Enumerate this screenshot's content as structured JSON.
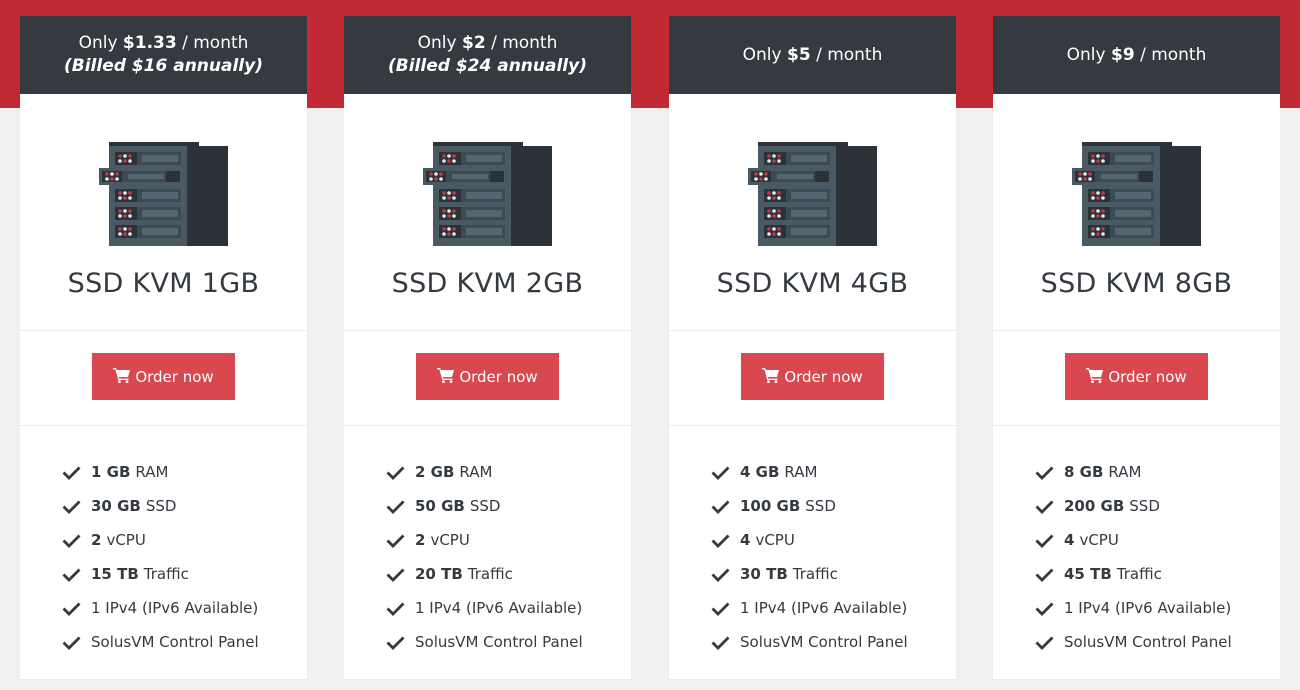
{
  "plans": [
    {
      "price_prefix": "Only",
      "price": "$1.33",
      "price_suffix": "/ month",
      "billed": "(Billed $16 annually)",
      "name": "SSD KVM 1GB",
      "order_label": "Order now",
      "features": [
        {
          "bold": "1 GB",
          "text": "RAM"
        },
        {
          "bold": "30 GB",
          "text": "SSD"
        },
        {
          "bold": "2",
          "text": "vCPU"
        },
        {
          "bold": "15 TB",
          "text": "Traffic"
        },
        {
          "bold": "",
          "text": "1 IPv4 (IPv6 Available)"
        },
        {
          "bold": "",
          "text": "SolusVM Control Panel"
        }
      ]
    },
    {
      "price_prefix": "Only",
      "price": "$2",
      "price_suffix": "/ month",
      "billed": "(Billed $24 annually)",
      "name": "SSD KVM 2GB",
      "order_label": "Order now",
      "features": [
        {
          "bold": "2 GB",
          "text": "RAM"
        },
        {
          "bold": "50 GB",
          "text": "SSD"
        },
        {
          "bold": "2",
          "text": "vCPU"
        },
        {
          "bold": "20 TB",
          "text": "Traffic"
        },
        {
          "bold": "",
          "text": "1 IPv4 (IPv6 Available)"
        },
        {
          "bold": "",
          "text": "SolusVM Control Panel"
        }
      ]
    },
    {
      "price_prefix": "Only",
      "price": "$5",
      "price_suffix": "/ month",
      "billed": "",
      "name": "SSD KVM 4GB",
      "order_label": "Order now",
      "features": [
        {
          "bold": "4 GB",
          "text": "RAM"
        },
        {
          "bold": "100 GB",
          "text": "SSD"
        },
        {
          "bold": "4",
          "text": "vCPU"
        },
        {
          "bold": "30 TB",
          "text": "Traffic"
        },
        {
          "bold": "",
          "text": "1 IPv4 (IPv6 Available)"
        },
        {
          "bold": "",
          "text": "SolusVM Control Panel"
        }
      ]
    },
    {
      "price_prefix": "Only",
      "price": "$9",
      "price_suffix": "/ month",
      "billed": "",
      "name": "SSD KVM 8GB",
      "order_label": "Order now",
      "features": [
        {
          "bold": "8 GB",
          "text": "RAM"
        },
        {
          "bold": "200 GB",
          "text": "SSD"
        },
        {
          "bold": "4",
          "text": "vCPU"
        },
        {
          "bold": "45 TB",
          "text": "Traffic"
        },
        {
          "bold": "",
          "text": "1 IPv4 (IPv6 Available)"
        },
        {
          "bold": "",
          "text": "SolusVM Control Panel"
        }
      ]
    }
  ],
  "icons": {
    "product": "server-rack-icon",
    "order": "shopping-cart-icon",
    "feature": "checkmark-icon"
  },
  "colors": {
    "band": "#c12a35",
    "header": "#343a40",
    "button": "#d9474f",
    "server_body": "#4a5a65",
    "server_dark": "#2b3339",
    "server_led": "#c13b47"
  }
}
